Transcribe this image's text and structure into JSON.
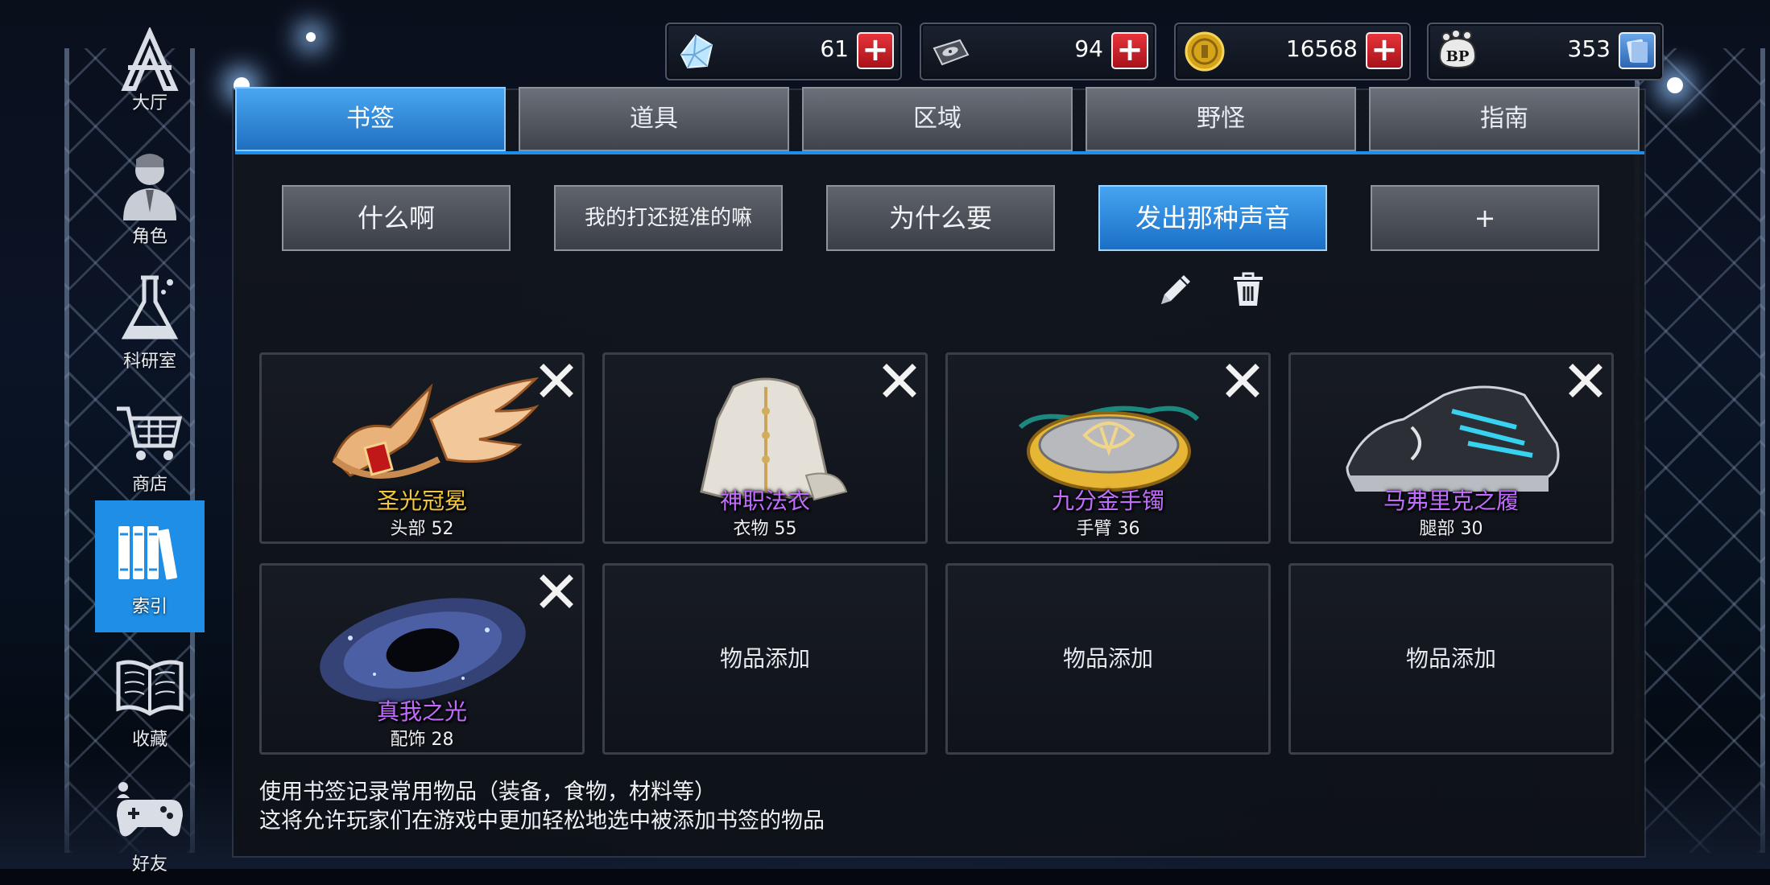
{
  "currency": [
    {
      "id": "diamond",
      "value": "61",
      "icon": "diamond-icon",
      "plus": "+"
    },
    {
      "id": "disk",
      "value": "94",
      "icon": "disk-icon",
      "plus": "+"
    },
    {
      "id": "coin",
      "value": "16568",
      "icon": "coin-icon",
      "plus": "+"
    },
    {
      "id": "bp",
      "value": "353",
      "icon": "bp-icon",
      "plus": ""
    }
  ],
  "sidebar": {
    "items": [
      {
        "label": "大厅",
        "icon": "lobby-icon"
      },
      {
        "label": "角色",
        "icon": "character-icon"
      },
      {
        "label": "科研室",
        "icon": "lab-flask-icon"
      },
      {
        "label": "商店",
        "icon": "shop-cart-icon"
      },
      {
        "label": "索引",
        "icon": "index-books-icon",
        "active": true
      },
      {
        "label": "收藏",
        "icon": "collection-book-icon"
      },
      {
        "label": "好友",
        "icon": "friends-gamepad-icon"
      }
    ]
  },
  "tabs": [
    {
      "label": "书签",
      "active": true
    },
    {
      "label": "道具"
    },
    {
      "label": "区域"
    },
    {
      "label": "野怪"
    },
    {
      "label": "指南"
    }
  ],
  "bookmarks": [
    {
      "label": "什么啊"
    },
    {
      "label": "我的打还挺准的嘛"
    },
    {
      "label": "为什么要"
    },
    {
      "label": "发出那种声音",
      "active": true
    },
    {
      "label": "+"
    }
  ],
  "tools": {
    "edit_icon": "pencil-icon",
    "delete_icon": "trash-icon"
  },
  "slots": [
    {
      "name": "圣光冠冕",
      "slot": "头部 52",
      "rarity_color": "#f3c73d",
      "art": "winged-crown"
    },
    {
      "name": "神职法衣",
      "slot": "衣物 55",
      "rarity_color": "#c26cff",
      "art": "white-robe"
    },
    {
      "name": "九分金手镯",
      "slot": "手臂 36",
      "rarity_color": "#c26cff",
      "art": "gold-bracelet"
    },
    {
      "name": "马弗里克之履",
      "slot": "腿部 30",
      "rarity_color": "#c26cff",
      "art": "sneakers"
    },
    {
      "name": "真我之光",
      "slot": "配饰 28",
      "rarity_color": "#c26cff",
      "art": "galaxy"
    },
    {
      "empty": "物品添加"
    },
    {
      "empty": "物品添加"
    },
    {
      "empty": "物品添加"
    }
  ],
  "hint": {
    "line1": "使用书签记录常用物品（装备，食物，材料等）",
    "line2": "这将允许玩家们在游戏中更加轻松地选中被添加书签的物品"
  },
  "colors": {
    "accent": "#1e8ee6",
    "close_red": "#e7343b",
    "gold_name": "#f3c73d",
    "purple_name": "#c26cff"
  }
}
